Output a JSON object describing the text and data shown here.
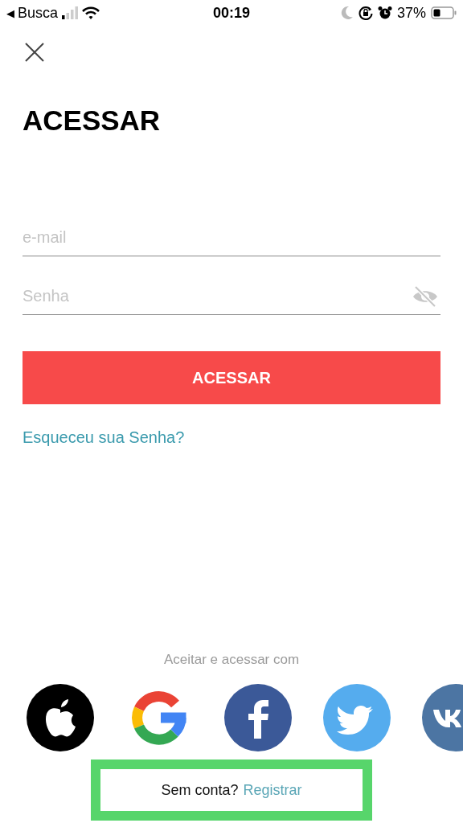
{
  "status_bar": {
    "back_arrow": "◀",
    "back_label": "Busca",
    "time": "00:19",
    "battery": "37%"
  },
  "title": "ACESSAR",
  "fields": [
    {
      "kind": "email",
      "placeholder": "e-mail"
    },
    {
      "kind": "password",
      "placeholder": "Senha"
    }
  ],
  "submit_button": "ACESSAR",
  "forgot_link": "Esqueceu sua Senha?",
  "social": {
    "caption": "Aceitar e acessar com",
    "providers": [
      {
        "kind": "apple"
      },
      {
        "kind": "google"
      },
      {
        "kind": "facebook"
      },
      {
        "kind": "twitter"
      },
      {
        "kind": "vk"
      }
    ]
  },
  "signup": {
    "prompt": "Sem conta?",
    "link": "Registrar"
  }
}
